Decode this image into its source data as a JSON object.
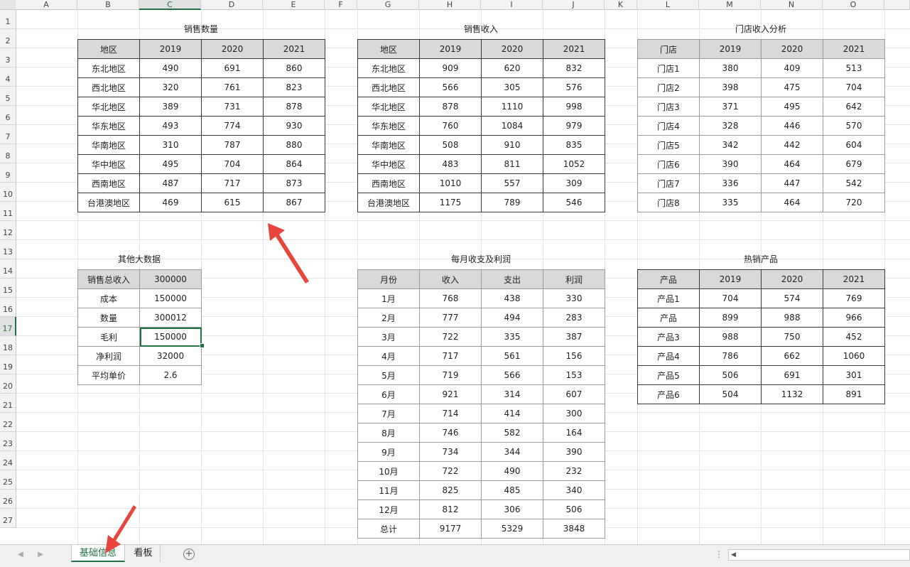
{
  "columns": [
    "A",
    "B",
    "C",
    "D",
    "E",
    "F",
    "G",
    "H",
    "I",
    "J",
    "K",
    "L",
    "M",
    "N",
    "O"
  ],
  "rows": [
    "1",
    "2",
    "3",
    "4",
    "5",
    "6",
    "7",
    "8",
    "9",
    "10",
    "11",
    "12",
    "13",
    "14",
    "15",
    "16",
    "17",
    "18",
    "19",
    "20",
    "21",
    "22",
    "23",
    "24",
    "25",
    "26",
    "27"
  ],
  "selected_column": "C",
  "selected_row": "17",
  "tables": {
    "sales_qty": {
      "title": "销售数量",
      "header": [
        "地区",
        "2019",
        "2020",
        "2021"
      ],
      "rows": [
        [
          "东北地区",
          "490",
          "691",
          "860"
        ],
        [
          "西北地区",
          "320",
          "761",
          "823"
        ],
        [
          "华北地区",
          "389",
          "731",
          "878"
        ],
        [
          "华东地区",
          "493",
          "774",
          "930"
        ],
        [
          "华南地区",
          "310",
          "787",
          "880"
        ],
        [
          "华中地区",
          "495",
          "704",
          "864"
        ],
        [
          "西南地区",
          "487",
          "717",
          "873"
        ],
        [
          "台港澳地区",
          "469",
          "615",
          "867"
        ]
      ]
    },
    "sales_rev": {
      "title": "销售收入",
      "header": [
        "地区",
        "2019",
        "2020",
        "2021"
      ],
      "rows": [
        [
          "东北地区",
          "909",
          "620",
          "832"
        ],
        [
          "西北地区",
          "566",
          "305",
          "576"
        ],
        [
          "华北地区",
          "878",
          "1110",
          "998"
        ],
        [
          "华东地区",
          "760",
          "1084",
          "979"
        ],
        [
          "华南地区",
          "508",
          "910",
          "835"
        ],
        [
          "华中地区",
          "483",
          "811",
          "1052"
        ],
        [
          "西南地区",
          "1010",
          "557",
          "309"
        ],
        [
          "台港澳地区",
          "1175",
          "789",
          "546"
        ]
      ]
    },
    "store_rev": {
      "title": "门店收入分析",
      "header": [
        "门店",
        "2019",
        "2020",
        "2021"
      ],
      "rows": [
        [
          "门店1",
          "380",
          "409",
          "513"
        ],
        [
          "门店2",
          "398",
          "475",
          "704"
        ],
        [
          "门店3",
          "371",
          "495",
          "642"
        ],
        [
          "门店4",
          "328",
          "446",
          "570"
        ],
        [
          "门店5",
          "342",
          "442",
          "604"
        ],
        [
          "门店6",
          "390",
          "464",
          "679"
        ],
        [
          "门店7",
          "336",
          "447",
          "542"
        ],
        [
          "门店8",
          "335",
          "464",
          "720"
        ]
      ]
    },
    "other": {
      "title": "其他大数据",
      "rows": [
        [
          "销售总收入",
          "300000"
        ],
        [
          "成本",
          "150000"
        ],
        [
          "数量",
          "300012"
        ],
        [
          "毛利",
          "150000"
        ],
        [
          "净利润",
          "32000"
        ],
        [
          "平均单价",
          "2.6"
        ]
      ]
    },
    "monthly": {
      "title": "每月收支及利润",
      "header": [
        "月份",
        "收入",
        "支出",
        "利润"
      ],
      "rows": [
        [
          "1月",
          "768",
          "438",
          "330"
        ],
        [
          "2月",
          "777",
          "494",
          "283"
        ],
        [
          "3月",
          "722",
          "335",
          "387"
        ],
        [
          "4月",
          "717",
          "561",
          "156"
        ],
        [
          "5月",
          "719",
          "566",
          "153"
        ],
        [
          "6月",
          "921",
          "314",
          "607"
        ],
        [
          "7月",
          "714",
          "414",
          "300"
        ],
        [
          "8月",
          "746",
          "582",
          "164"
        ],
        [
          "9月",
          "734",
          "344",
          "390"
        ],
        [
          "10月",
          "722",
          "490",
          "232"
        ],
        [
          "11月",
          "825",
          "485",
          "340"
        ],
        [
          "12月",
          "812",
          "306",
          "506"
        ],
        [
          "总计",
          "9177",
          "5329",
          "3848"
        ]
      ]
    },
    "hot_products": {
      "title": "热销产品",
      "header": [
        "产品",
        "2019",
        "2020",
        "2021"
      ],
      "rows": [
        [
          "产品1",
          "704",
          "574",
          "769"
        ],
        [
          "产品",
          "899",
          "988",
          "966"
        ],
        [
          "产品3",
          "988",
          "750",
          "452"
        ],
        [
          "产品4",
          "786",
          "662",
          "1060"
        ],
        [
          "产品5",
          "506",
          "691",
          "301"
        ],
        [
          "产品6",
          "504",
          "1132",
          "891"
        ]
      ]
    }
  },
  "sheet_tabs": [
    {
      "label": "基础信息",
      "active": true
    },
    {
      "label": "看板",
      "active": false
    }
  ],
  "add_sheet_label": "+",
  "colors": {
    "accent": "#217346",
    "header_fill": "#d9d9d9",
    "arrow": "#e8453c"
  }
}
